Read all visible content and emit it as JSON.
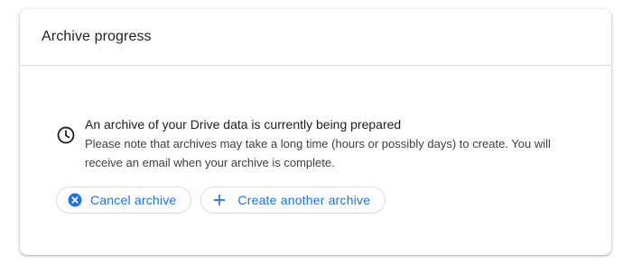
{
  "card": {
    "title": "Archive progress"
  },
  "status": {
    "icon": "clock-icon",
    "headline": "An archive of your Drive data is currently being prepared",
    "note": "Please note that archives may take a long time (hours or possibly days) to create. You will receive an email when your archive is complete."
  },
  "actions": {
    "cancel_label": "Cancel archive",
    "cancel_icon": "cancel-circle-icon",
    "create_label": "Create another archive",
    "create_icon": "plus-icon"
  },
  "colors": {
    "accent": "#1a73e8",
    "text_primary": "#202124",
    "text_secondary": "#3c4043",
    "border": "#dadce0"
  }
}
